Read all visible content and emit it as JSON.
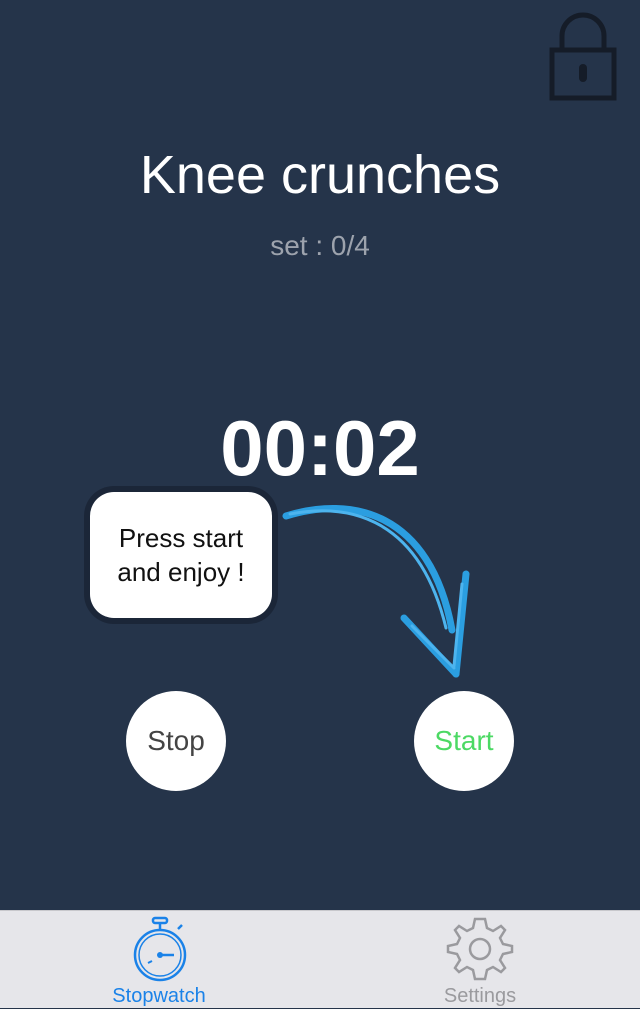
{
  "exercise": {
    "title": "Knee crunches",
    "set_text": "set : 0/4"
  },
  "timer": {
    "display": "00:02"
  },
  "hint": {
    "text_line1": "Press start",
    "text_line2": "and enjoy !"
  },
  "controls": {
    "stop_label": "Stop",
    "start_label": "Start"
  },
  "tabbar": {
    "tabs": [
      {
        "label": "Stopwatch",
        "icon": "stopwatch-icon",
        "active": true
      },
      {
        "label": "Settings",
        "icon": "gear-icon",
        "active": false
      }
    ]
  },
  "icons": {
    "lock": "lock-icon",
    "arrow": "curved-arrow-icon"
  },
  "colors": {
    "background": "#25344a",
    "start_text": "#4cd964",
    "active_tab": "#1a82e8",
    "inactive_tab": "#9a9a9e",
    "arrow": "#2b9ee0"
  }
}
